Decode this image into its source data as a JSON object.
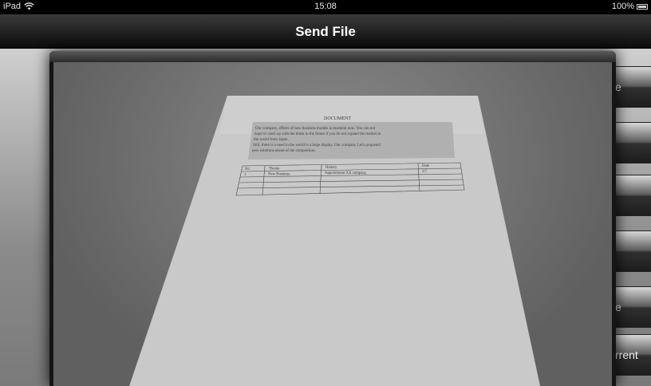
{
  "status_bar": {
    "device": "iPad",
    "time": "15:08",
    "battery": "100%",
    "icons": [
      "wifi-icon",
      "battery-icon"
    ]
  },
  "nav_bar": {
    "title": "Send File"
  },
  "side_buttons": [
    {
      "label": "e"
    },
    {
      "label": ""
    },
    {
      "label": ""
    },
    {
      "label": ""
    },
    {
      "label": "e"
    },
    {
      "label": "rrent"
    }
  ],
  "document": {
    "heading": "DOCUMENT",
    "paragraph_lines": [
      "Our company, efforts of new business models is essential now. You can not",
      "hope to catch up with the times in the future if you do not expand the market to",
      "the world from Japan.",
      "Still, there is a need in the world is a large display. Our company Let's proposed",
      "new solutions ahead of the competition."
    ],
    "table": {
      "headers": [
        "No",
        "Theme",
        "History",
        "Date"
      ],
      "rows": [
        [
          "1",
          "New Business",
          "Appointment XX company",
          "3/7"
        ],
        [
          "",
          "",
          "",
          ""
        ],
        [
          "",
          "",
          "",
          ""
        ],
        [
          "",
          "",
          "",
          ""
        ],
        [
          "",
          "",
          "",
          ""
        ]
      ]
    }
  }
}
